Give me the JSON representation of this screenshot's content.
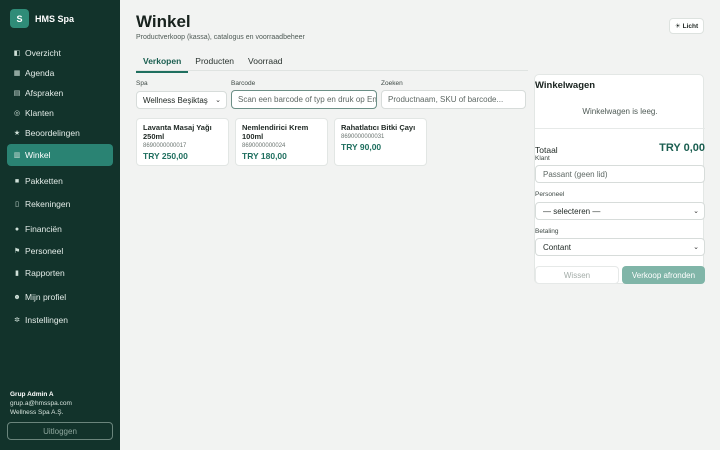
{
  "brand": {
    "logo_letter": "S",
    "name": "HMS Spa"
  },
  "nav": [
    {
      "icon": "home-icon",
      "glyph": "◧",
      "label": "Overzicht"
    },
    {
      "icon": "agenda-icon",
      "glyph": "▦",
      "label": "Agenda"
    },
    {
      "icon": "appointments-icon",
      "glyph": "▤",
      "label": "Afspraken"
    },
    {
      "icon": "customers-icon",
      "glyph": "◎",
      "label": "Klanten"
    },
    {
      "icon": "star-icon",
      "glyph": "★",
      "label": "Beoordelingen"
    },
    {
      "icon": "shop-icon",
      "glyph": "▥",
      "label": "Winkel"
    },
    {
      "icon": "package-icon",
      "glyph": "■",
      "label": "Pakketten"
    },
    {
      "icon": "receipt-icon",
      "glyph": "▯",
      "label": "Rekeningen"
    },
    {
      "icon": "money-icon",
      "glyph": "●",
      "label": "Financiën"
    },
    {
      "icon": "flag-icon",
      "glyph": "⚑",
      "label": "Personeel"
    },
    {
      "icon": "chart-icon",
      "glyph": "▮",
      "label": "Rapporten"
    },
    {
      "icon": "user-icon",
      "glyph": "☻",
      "label": "Mijn profiel"
    },
    {
      "icon": "gear-icon",
      "glyph": "✲",
      "label": "Instellingen"
    }
  ],
  "active_nav": "Winkel",
  "user": {
    "name": "Grup Admin A",
    "email": "grup.a@hmsspa.com",
    "company": "Wellness Spa A.Ş.",
    "logout_label": "Uitloggen"
  },
  "page": {
    "title": "Winkel",
    "subtitle": "Productverkoop (kassa), catalogus en voorraadbeheer",
    "theme_label": "Licht",
    "theme_glyph": "☀"
  },
  "tabs": [
    {
      "label": "Verkopen"
    },
    {
      "label": "Producten"
    },
    {
      "label": "Voorraad"
    }
  ],
  "filters": {
    "spa_label": "Spa",
    "spa_value": "Wellness Beşiktaş",
    "barcode_label": "Barcode",
    "barcode_placeholder": "Scan een barcode of typ en druk op Enter",
    "search_label": "Zoeken",
    "search_placeholder": "Productnaam, SKU of barcode..."
  },
  "products": [
    {
      "name": "Lavanta Masaj Yağı 250ml",
      "sku": "8690000000017",
      "price": "TRY 250,00"
    },
    {
      "name": "Nemlendirici Krem 100ml",
      "sku": "8690000000024",
      "price": "TRY 180,00"
    },
    {
      "name": "Rahatlatıcı Bitki Çayı",
      "sku": "8690000000031",
      "price": "TRY 90,00"
    }
  ],
  "cart": {
    "title": "Winkelwagen",
    "empty_text": "Winkelwagen is leeg.",
    "total_label": "Totaal",
    "total_value": "TRY 0,00",
    "customer_label": "Klant",
    "customer_placeholder": "Passant (geen lid)",
    "staff_label": "Personeel",
    "staff_value": "— selecteren —",
    "payment_label": "Betaling",
    "payment_value": "Contant",
    "clear_label": "Wissen",
    "finish_label": "Verkoop afronden"
  },
  "colors": {
    "sidebar_bg": "#12332b",
    "accent": "#2a8373",
    "brand_green": "#1f6f5f"
  }
}
